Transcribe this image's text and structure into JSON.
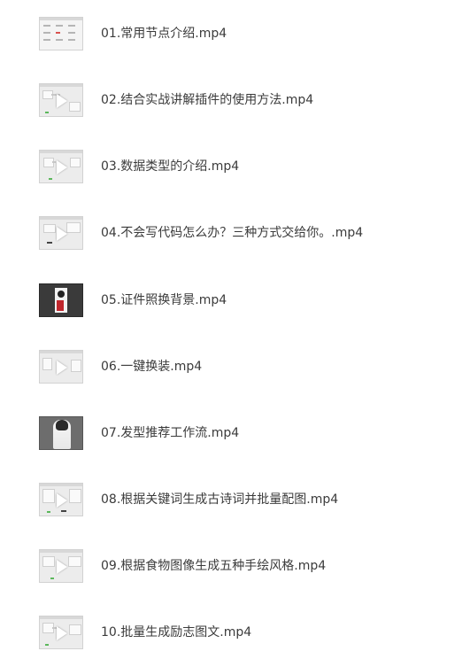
{
  "files": [
    {
      "name": "01.常用节点介绍.mp4",
      "thumbnail": "workflow-table-thumbnail"
    },
    {
      "name": "02.结合实战讲解插件的使用方法.mp4",
      "thumbnail": "node-graph-thumbnail"
    },
    {
      "name": "03.数据类型的介绍.mp4",
      "thumbnail": "node-graph-thumbnail"
    },
    {
      "name": "04.不会写代码怎么办？三种方式交给你。.mp4",
      "thumbnail": "node-graph-thumbnail"
    },
    {
      "name": "05.证件照换背景.mp4",
      "thumbnail": "portrait-photo-thumbnail"
    },
    {
      "name": "06.一键换装.mp4",
      "thumbnail": "node-graph-thumbnail"
    },
    {
      "name": "07.发型推荐工作流.mp4",
      "thumbnail": "hairstyle-photo-thumbnail"
    },
    {
      "name": "08.根据关键词生成古诗词并批量配图.mp4",
      "thumbnail": "node-graph-thumbnail"
    },
    {
      "name": "09.根据食物图像生成五种手绘风格.mp4",
      "thumbnail": "node-graph-thumbnail"
    },
    {
      "name": "10.批量生成励志图文.mp4",
      "thumbnail": "node-graph-thumbnail"
    }
  ],
  "colors": {
    "text": "#3b3b3b",
    "background": "#ffffff",
    "thumbnail_border": "#d2d2d2"
  }
}
